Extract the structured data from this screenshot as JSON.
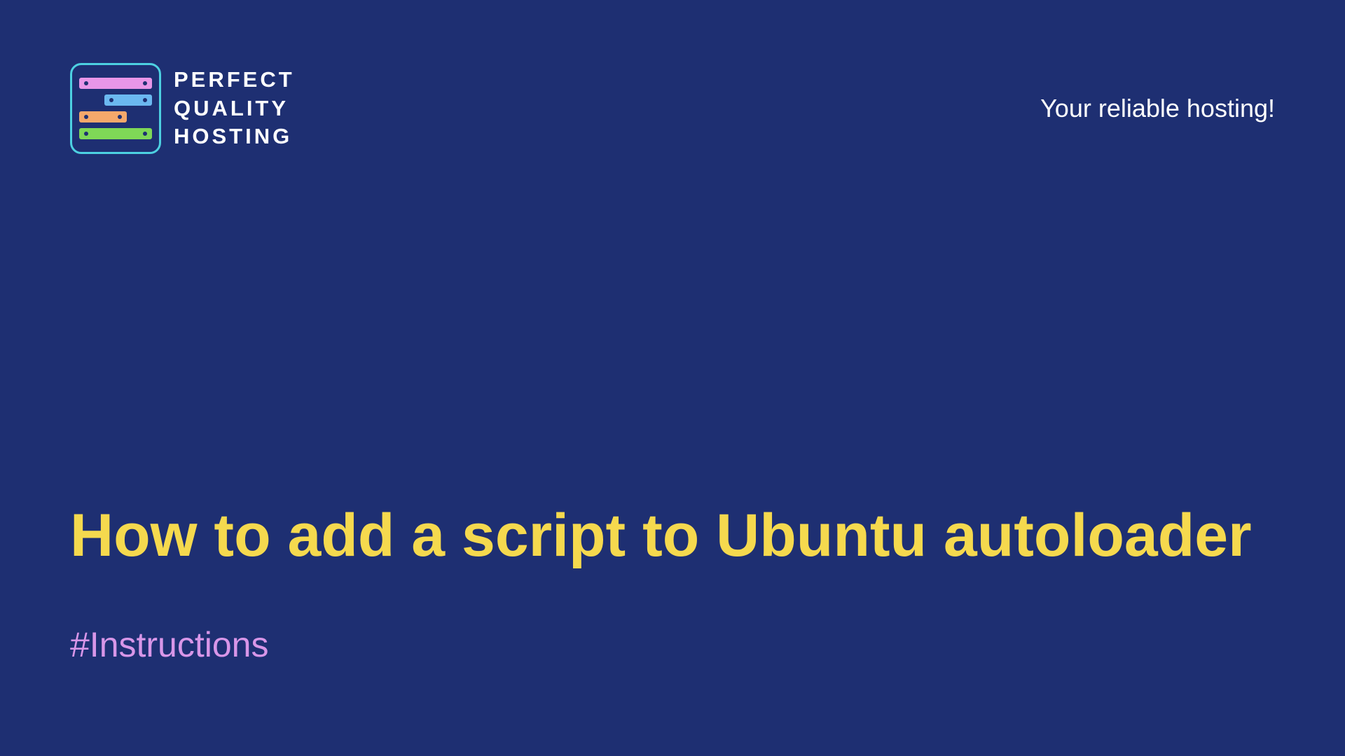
{
  "logo": {
    "line1": "PERFECT",
    "line2": "QUALITY",
    "line3": "HOSTING"
  },
  "tagline": "Your reliable hosting!",
  "title": "How to add a script to Ubuntu autoloader",
  "category": "#Instructions"
}
